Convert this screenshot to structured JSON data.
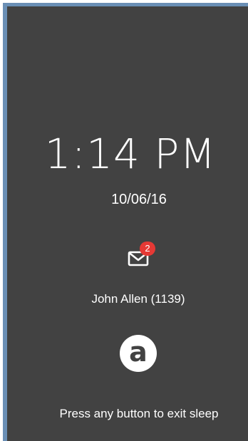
{
  "lock_screen": {
    "time": "1:14 PM",
    "date": "10/06/16",
    "unread_count": "2",
    "caller": "John Allen (1139)",
    "logo_letter": "a",
    "exit_hint": "Press any button to exit sleep"
  },
  "icons": {
    "mail": "envelope-icon",
    "logo": "logo-icon"
  },
  "colors": {
    "background": "#424242",
    "badge": "#e53935",
    "text": "#ffffff",
    "frame": "#6a8fb5"
  }
}
